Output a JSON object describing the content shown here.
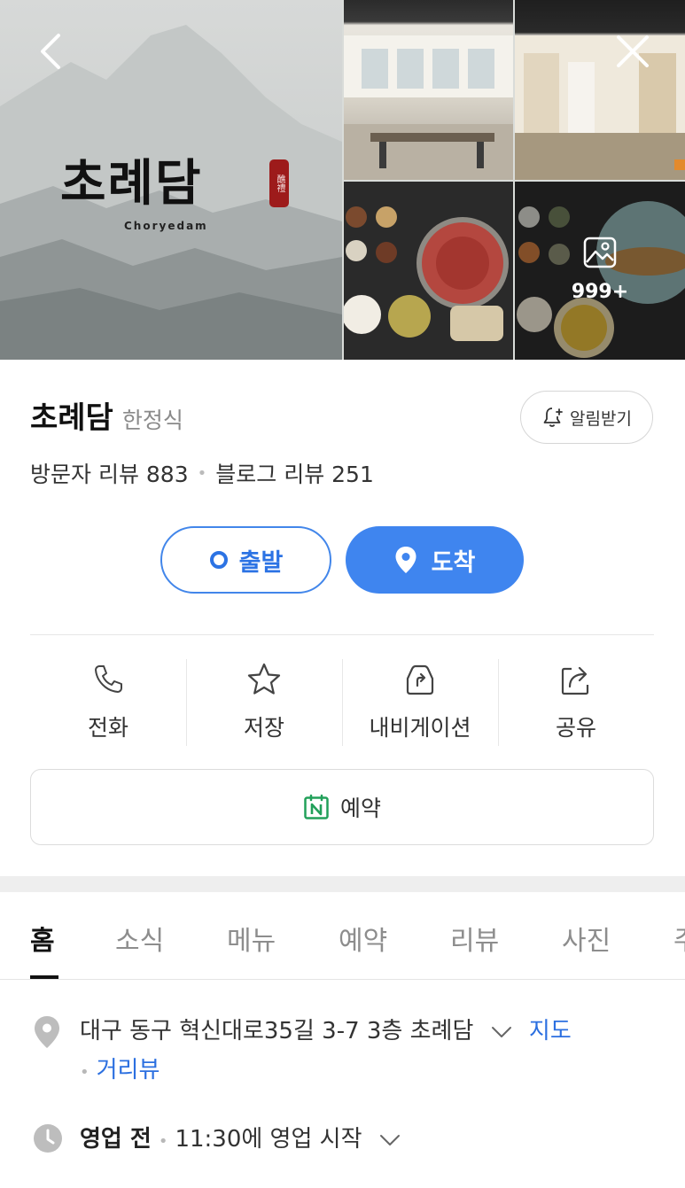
{
  "gallery": {
    "brand_ko": "초례담",
    "brand_en": "Choryedam",
    "seal_text": "醮禮",
    "more_count": "999+"
  },
  "header": {
    "name": "초례담",
    "category": "한정식",
    "alarm_label": "알림받기",
    "visitor_reviews": "방문자 리뷰 883",
    "blog_reviews": "블로그 리뷰 251"
  },
  "route": {
    "depart_label": "출발",
    "arrive_label": "도착"
  },
  "actions": [
    {
      "label": "전화",
      "icon": "phone-icon"
    },
    {
      "label": "저장",
      "icon": "star-icon"
    },
    {
      "label": "내비게이션",
      "icon": "car-navigation-icon"
    },
    {
      "label": "공유",
      "icon": "share-icon"
    }
  ],
  "reserve": {
    "label": "예약",
    "icon": "naver-calendar-icon"
  },
  "tabs": [
    {
      "label": "홈",
      "active": true
    },
    {
      "label": "소식"
    },
    {
      "label": "메뉴"
    },
    {
      "label": "예약"
    },
    {
      "label": "리뷰"
    },
    {
      "label": "사진"
    },
    {
      "label": "주"
    }
  ],
  "info": {
    "address": "대구 동구 혁신대로35길 3-7 3층 초례담",
    "map_link": "지도",
    "street_view_link": "거리뷰",
    "hours_status": "영업 전",
    "hours_detail": "11:30에 영업 시작"
  },
  "colors": {
    "accent_blue": "#3f85ef",
    "link_blue": "#2b6fe0",
    "naver_green": "#22a05a"
  }
}
